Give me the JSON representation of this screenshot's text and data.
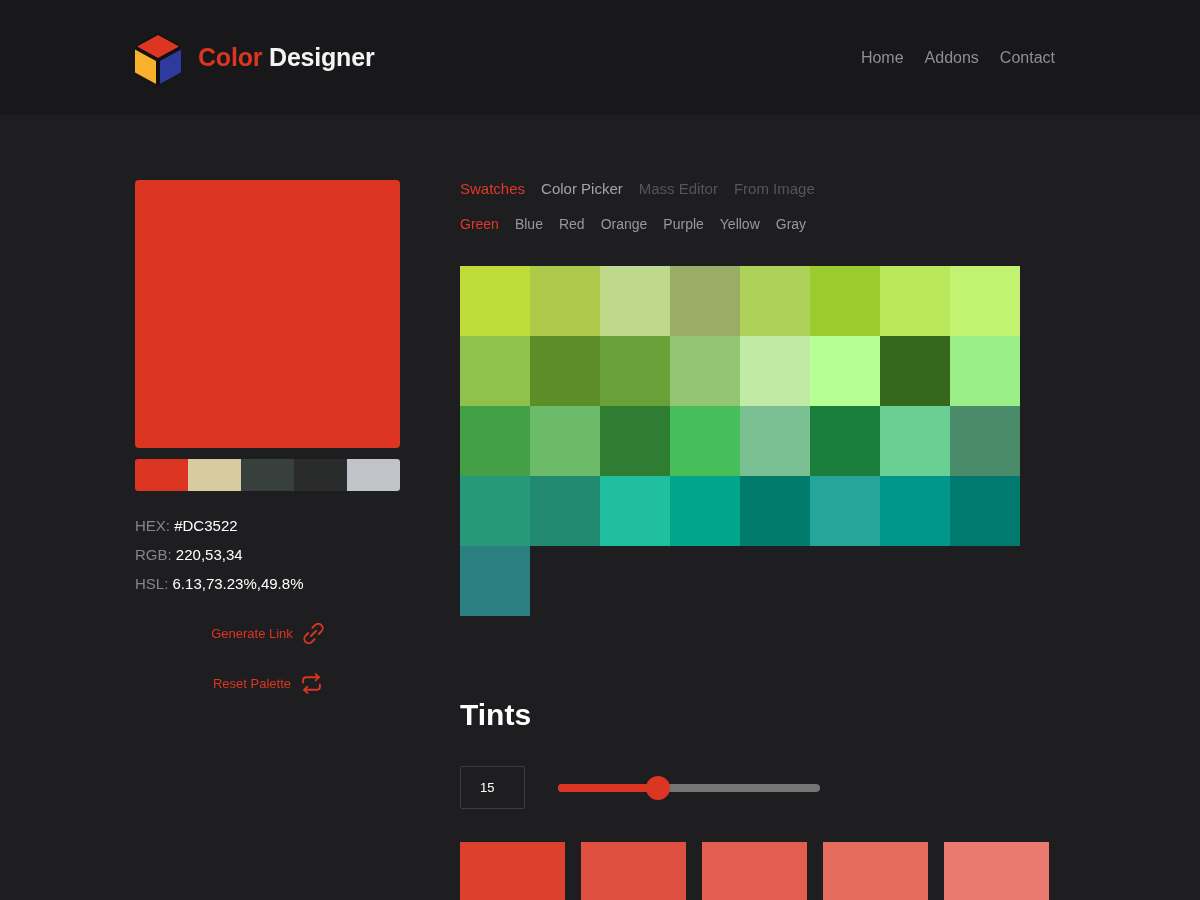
{
  "header": {
    "logo": {
      "accent": "Color",
      "text": "Designer"
    },
    "nav": [
      "Home",
      "Addons",
      "Contact"
    ]
  },
  "preview": {
    "color": "#dc3522",
    "palette": [
      {
        "color": "#dc3522"
      },
      {
        "color": "#d9cba0"
      },
      {
        "color": "#38403e"
      },
      {
        "color": "#2a2c2b"
      },
      {
        "color": "#c0c4c8"
      }
    ],
    "codes": [
      {
        "label": "HEX:",
        "value": "#DC3522"
      },
      {
        "label": "RGB:",
        "value": "220,53,34"
      },
      {
        "label": "HSL:",
        "value": "6.13,73.23%,49.8%"
      }
    ],
    "actions": [
      {
        "kind": "link",
        "label": "Generate Link"
      },
      {
        "kind": "reset",
        "label": "Reset Palette"
      }
    ]
  },
  "tabs": [
    {
      "label": "Swatches",
      "selected": true,
      "disabled": false
    },
    {
      "label": "Color Picker",
      "selected": false,
      "disabled": false
    },
    {
      "label": "Mass Editor",
      "selected": false,
      "disabled": true
    },
    {
      "label": "From Image",
      "selected": false,
      "disabled": true
    }
  ],
  "swatches": {
    "groups": [
      {
        "label": "Green",
        "selected": true
      },
      {
        "label": "Blue",
        "selected": false
      },
      {
        "label": "Red",
        "selected": false
      },
      {
        "label": "Orange",
        "selected": false
      },
      {
        "label": "Purple",
        "selected": false
      },
      {
        "label": "Yellow",
        "selected": false
      },
      {
        "label": "Gray",
        "selected": false
      }
    ],
    "grid": [
      {
        "color": "#c0dc38"
      },
      {
        "color": "#afc94a"
      },
      {
        "color": "#bfd98c"
      },
      {
        "color": "#99ad66"
      },
      {
        "color": "#aed15a"
      },
      {
        "color": "#9bcb2d"
      },
      {
        "color": "#b9e85a"
      },
      {
        "color": "#c1f270"
      },
      {
        "color": "#8fc24c"
      },
      {
        "color": "#5b8e27"
      },
      {
        "color": "#69a138"
      },
      {
        "color": "#94c573"
      },
      {
        "color": "#c0eaa5"
      },
      {
        "color": "#b5ff94"
      },
      {
        "color": "#35671c"
      },
      {
        "color": "#9aef87"
      },
      {
        "color": "#43a047"
      },
      {
        "color": "#6cbb6a"
      },
      {
        "color": "#2e7d32"
      },
      {
        "color": "#46bf5a"
      },
      {
        "color": "#7ac093"
      },
      {
        "color": "#1a7f3a"
      },
      {
        "color": "#69cf93"
      },
      {
        "color": "#4a8c69"
      },
      {
        "color": "#26997a"
      },
      {
        "color": "#238a72"
      },
      {
        "color": "#1fbf9f"
      },
      {
        "color": "#00a58a"
      },
      {
        "color": "#007b6c"
      },
      {
        "color": "#26a69a"
      },
      {
        "color": "#00968a"
      },
      {
        "color": "#00796e"
      },
      {
        "color": "#2a8080"
      }
    ]
  },
  "tints": {
    "title": "Tints",
    "amount": {
      "value": "15"
    },
    "slider": {
      "level": 0.38
    },
    "swatches": [
      {
        "color": "#dd402f"
      },
      {
        "color": "#e05040"
      },
      {
        "color": "#e45e50"
      },
      {
        "color": "#e56c5e"
      },
      {
        "color": "#ea7a6e"
      }
    ]
  }
}
